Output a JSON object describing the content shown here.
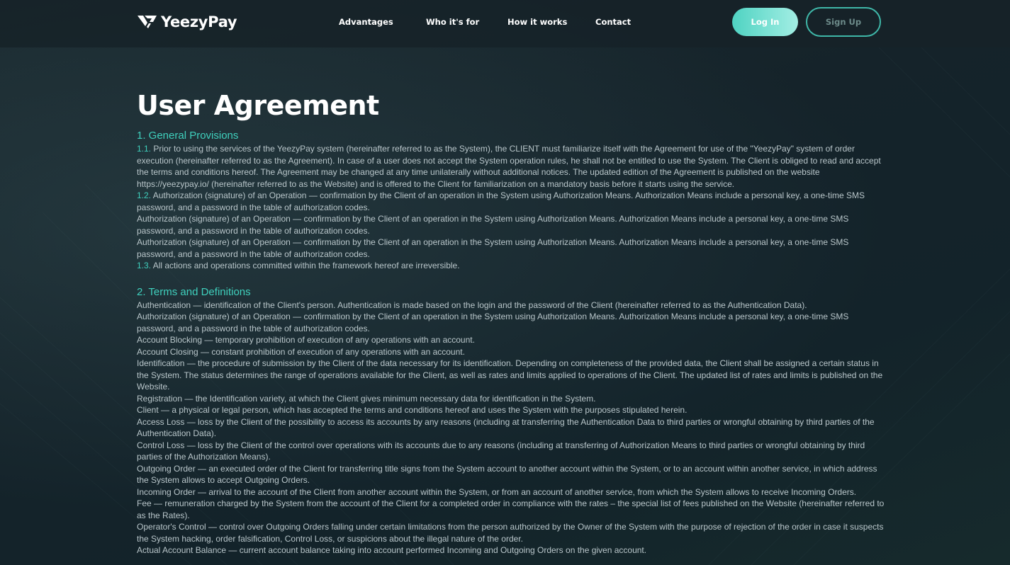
{
  "header": {
    "brand": "YeezyPay",
    "nav": [
      "Advantages",
      "Who it's for",
      "How it works",
      "Contact"
    ],
    "login_label": "Log In",
    "signup_label": "Sign Up"
  },
  "colors": {
    "accent": "#3fd0bd",
    "background": "#15232a",
    "text": "#b9c6ca"
  },
  "icons": {
    "logo": "yeezypay-logo-icon"
  },
  "main": {
    "title": "User Agreement",
    "sections": [
      {
        "heading": "1. General Provisions",
        "paragraphs": [
          {
            "num": "1.1.",
            "text": " Prior to using the services of the YeezyPay system (hereinafter referred to as the System), the CLIENT must familiarize itself with the Agreement for use of the \"YeezyPay\" system of order execution (hereinafter referred to as the Agreement). In case of a user does not accept the System operation rules, he shall not be entitled to use the System. The Client is obliged to read and accept the terms and conditions hereof. The Agreement may be changed at any time unilaterally without additional notices. The updated edition of the Agreement is published on the website https://yeezypay.io/ (hereinafter referred to as the Website) and is offered to the Client for familiarization on a mandatory basis before it starts using the service."
          },
          {
            "num": "1.2.",
            "text": " Authorization (signature) of an Operation — confirmation by the Client of an operation in the System using Authorization Means. Authorization Means include a personal key, a one-time SMS password, and a password in the table of authorization codes."
          },
          {
            "num": "",
            "text": "Authorization (signature) of an Operation — confirmation by the Client of an operation in the System using Authorization Means. Authorization Means include a personal key, a one-time SMS password, and a password in the table of authorization codes."
          },
          {
            "num": "",
            "text": "Authorization (signature) of an Operation — confirmation by the Client of an operation in the System using Authorization Means. Authorization Means include a personal key, a one-time SMS password, and a password in the table of authorization codes."
          },
          {
            "num": "1.3.",
            "text": " All actions and operations committed within the framework hereof are irreversible."
          }
        ]
      },
      {
        "heading": "2. Terms and Definitions",
        "paragraphs": [
          {
            "num": "",
            "text": "Authentication — identification of the Client's person. Authentication is made based on the login and the password of the Client (hereinafter referred to as the Authentication Data)."
          },
          {
            "num": "",
            "text": "Authorization (signature) of an Operation — confirmation by the Client of an operation in the System using Authorization Means. Authorization Means include a personal key, a one-time SMS password, and a password in the table of authorization codes."
          },
          {
            "num": "",
            "text": "Account Blocking — temporary prohibition of execution of any operations with an account."
          },
          {
            "num": "",
            "text": "Account Closing — constant prohibition of execution of any operations with an account."
          },
          {
            "num": "",
            "text": "Identification — the procedure of submission by the Client of the data necessary for its identification. Depending on completeness of the provided data, the Client shall be assigned a certain status in the System. The status determines the range of operations available for the Client, as well as rates and limits applied to operations of the Client. The updated list of rates and limits is published on the Website."
          },
          {
            "num": "",
            "text": "Registration — the Identification variety, at which the Client gives minimum necessary data for identification in the System."
          },
          {
            "num": "",
            "text": "Client — a physical or legal person, which has accepted the terms and conditions hereof and uses the System with the purposes stipulated herein."
          },
          {
            "num": "",
            "text": "Access Loss — loss by the Client of the possibility to access its accounts by any reasons (including at transferring the Authentication Data to third parties or wrongful obtaining by third parties of the Authentication Data)."
          },
          {
            "num": "",
            "text": "Control Loss — loss by the Client of the control over operations with its accounts due to any reasons (including at transferring of Authorization Means to third parties or wrongful obtaining by third parties of the Authorization Means)."
          },
          {
            "num": "",
            "text": "Outgoing Order — an executed order of the Client for transferring title signs from the System account to another account within the System, or to an account within another service, in which address the System allows to accept Outgoing Orders."
          },
          {
            "num": "",
            "text": "Incoming Order — arrival to the account of the Client from another account within the System, or from an account of another service, from which the System allows to receive Incoming Orders."
          },
          {
            "num": "",
            "text": "Fee — remuneration charged by the System from the account of the Client for a completed order in compliance with the rates – the special list of fees published on the Website (hereinafter referred to as the Rates)."
          },
          {
            "num": "",
            "text": "Operator's Control — control over Outgoing Orders falling under certain limitations from the person authorized by the Owner of the System with the purpose of rejection of the order in case it suspects the System hacking, order falsification, Control Loss, or suspicions about the illegal nature of the order."
          },
          {
            "num": "",
            "text": "Actual Account Balance — current account balance taking into account performed Incoming and Outgoing Orders on the given account."
          }
        ]
      }
    ]
  }
}
